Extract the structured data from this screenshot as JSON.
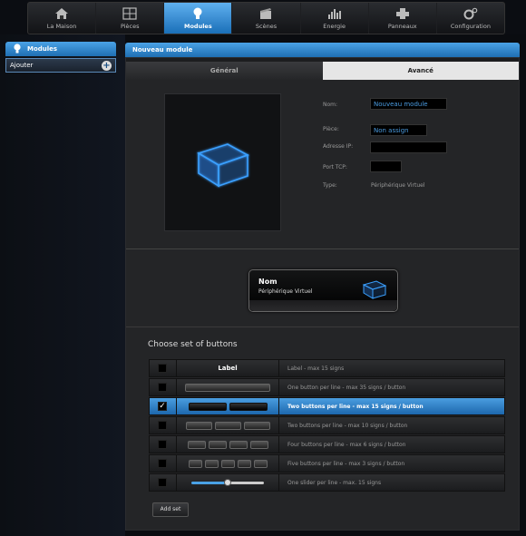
{
  "nav": {
    "items": [
      {
        "label": "La Maison",
        "icon": "house-icon"
      },
      {
        "label": "Pièces",
        "icon": "rooms-icon"
      },
      {
        "label": "Modules",
        "icon": "bulb-icon"
      },
      {
        "label": "Scènes",
        "icon": "scenes-icon"
      },
      {
        "label": "Energie",
        "icon": "energy-chart-icon"
      },
      {
        "label": "Panneaux",
        "icon": "panels-icon"
      },
      {
        "label": "Configuration",
        "icon": "gear-icon"
      }
    ],
    "active": "Modules"
  },
  "sidebar": {
    "title": "Modules",
    "add_label": "Ajouter"
  },
  "main": {
    "title": "Nouveau module",
    "tabs": [
      {
        "label": "Général"
      },
      {
        "label": "Avancé"
      }
    ],
    "active_tab": "Avancé",
    "form": {
      "name_label": "Nom:",
      "name_value": "Nouveau module",
      "room_label": "Pièce:",
      "room_value": "Non assign",
      "ip_label": "Adresse IP:",
      "ip_value": "",
      "port_label": "Port TCP:",
      "port_value": "",
      "type_label": "Type:",
      "type_value": "Périphérique Virtuel"
    },
    "preview": {
      "name": "Nom",
      "type": "Périphérique Virtuel"
    },
    "buttons_section": {
      "title": "Choose set of buttons",
      "label_sample": "Label",
      "rows": [
        {
          "desc": "Label - max 15 signs",
          "checked": false
        },
        {
          "desc": "One button per line - max 35 signs / button",
          "checked": false
        },
        {
          "desc": "Two buttons per line - max 15 signs / button",
          "checked": true
        },
        {
          "desc": "Two buttons per line - max 10 signs / button",
          "checked": false
        },
        {
          "desc": "Four buttons per line - max 6 signs / button",
          "checked": false
        },
        {
          "desc": "Five buttons per line - max 3 signs / button",
          "checked": false
        },
        {
          "desc": "One slider per line - max. 15 signs",
          "checked": false
        }
      ],
      "check_mark": "✓",
      "add_button": "Add set"
    }
  },
  "colors": {
    "accent": "#2f86d0",
    "background": "#0a0c10",
    "panel": "#242527"
  }
}
